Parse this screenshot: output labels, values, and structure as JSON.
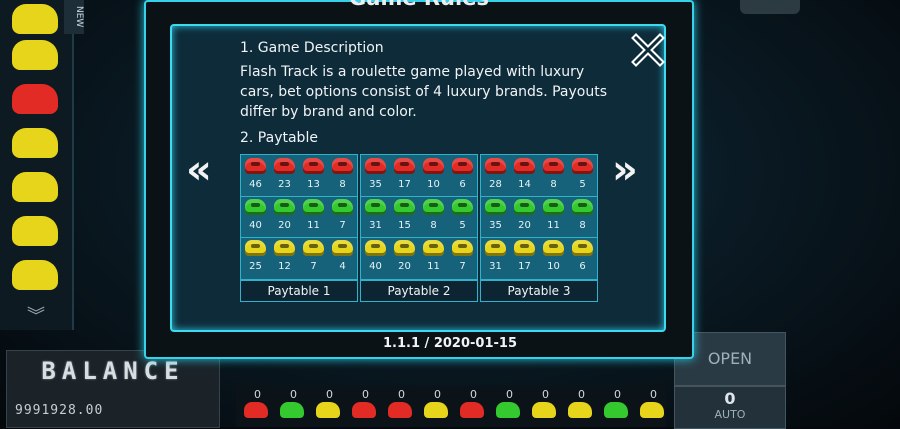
{
  "window": {
    "title": "Game Rules",
    "version": "1.1.1 / 2020-01-15"
  },
  "rules": {
    "section1_title": "1. Game Description",
    "section1_text": "Flash Track is a roulette game played with luxury cars, bet options consist of 4 luxury brands. Payouts differ by brand and color.",
    "section2_title": "2. Paytable"
  },
  "colors": {
    "red": "#e32b26",
    "green": "#33c92f",
    "yellow": "#e6d51a",
    "accent": "#35d2e9"
  },
  "paytables": [
    {
      "label": "Paytable 1",
      "rows": [
        {
          "color": "red",
          "payouts": [
            "46",
            "23",
            "13",
            "8"
          ]
        },
        {
          "color": "green",
          "payouts": [
            "40",
            "20",
            "11",
            "7"
          ]
        },
        {
          "color": "yellow",
          "payouts": [
            "25",
            "12",
            "7",
            "4"
          ]
        }
      ]
    },
    {
      "label": "Paytable 2",
      "rows": [
        {
          "color": "red",
          "payouts": [
            "35",
            "17",
            "10",
            "6"
          ]
        },
        {
          "color": "green",
          "payouts": [
            "31",
            "15",
            "8",
            "5"
          ]
        },
        {
          "color": "yellow",
          "payouts": [
            "40",
            "20",
            "11",
            "7"
          ]
        }
      ]
    },
    {
      "label": "Paytable 3",
      "rows": [
        {
          "color": "red",
          "payouts": [
            "28",
            "14",
            "8",
            "5"
          ]
        },
        {
          "color": "green",
          "payouts": [
            "35",
            "20",
            "11",
            "8"
          ]
        },
        {
          "color": "yellow",
          "payouts": [
            "31",
            "17",
            "10",
            "6"
          ]
        }
      ]
    }
  ],
  "balance": {
    "label": "BALANCE",
    "value": "9991928.00"
  },
  "controls": {
    "open_label": "OPEN",
    "auto_count": "0",
    "auto_label": "AUTO",
    "left_tab": "NEW"
  },
  "bet_counts": [
    "0",
    "0",
    "0",
    "0",
    "0",
    "0",
    "0",
    "0",
    "0",
    "0",
    "0",
    "0"
  ]
}
